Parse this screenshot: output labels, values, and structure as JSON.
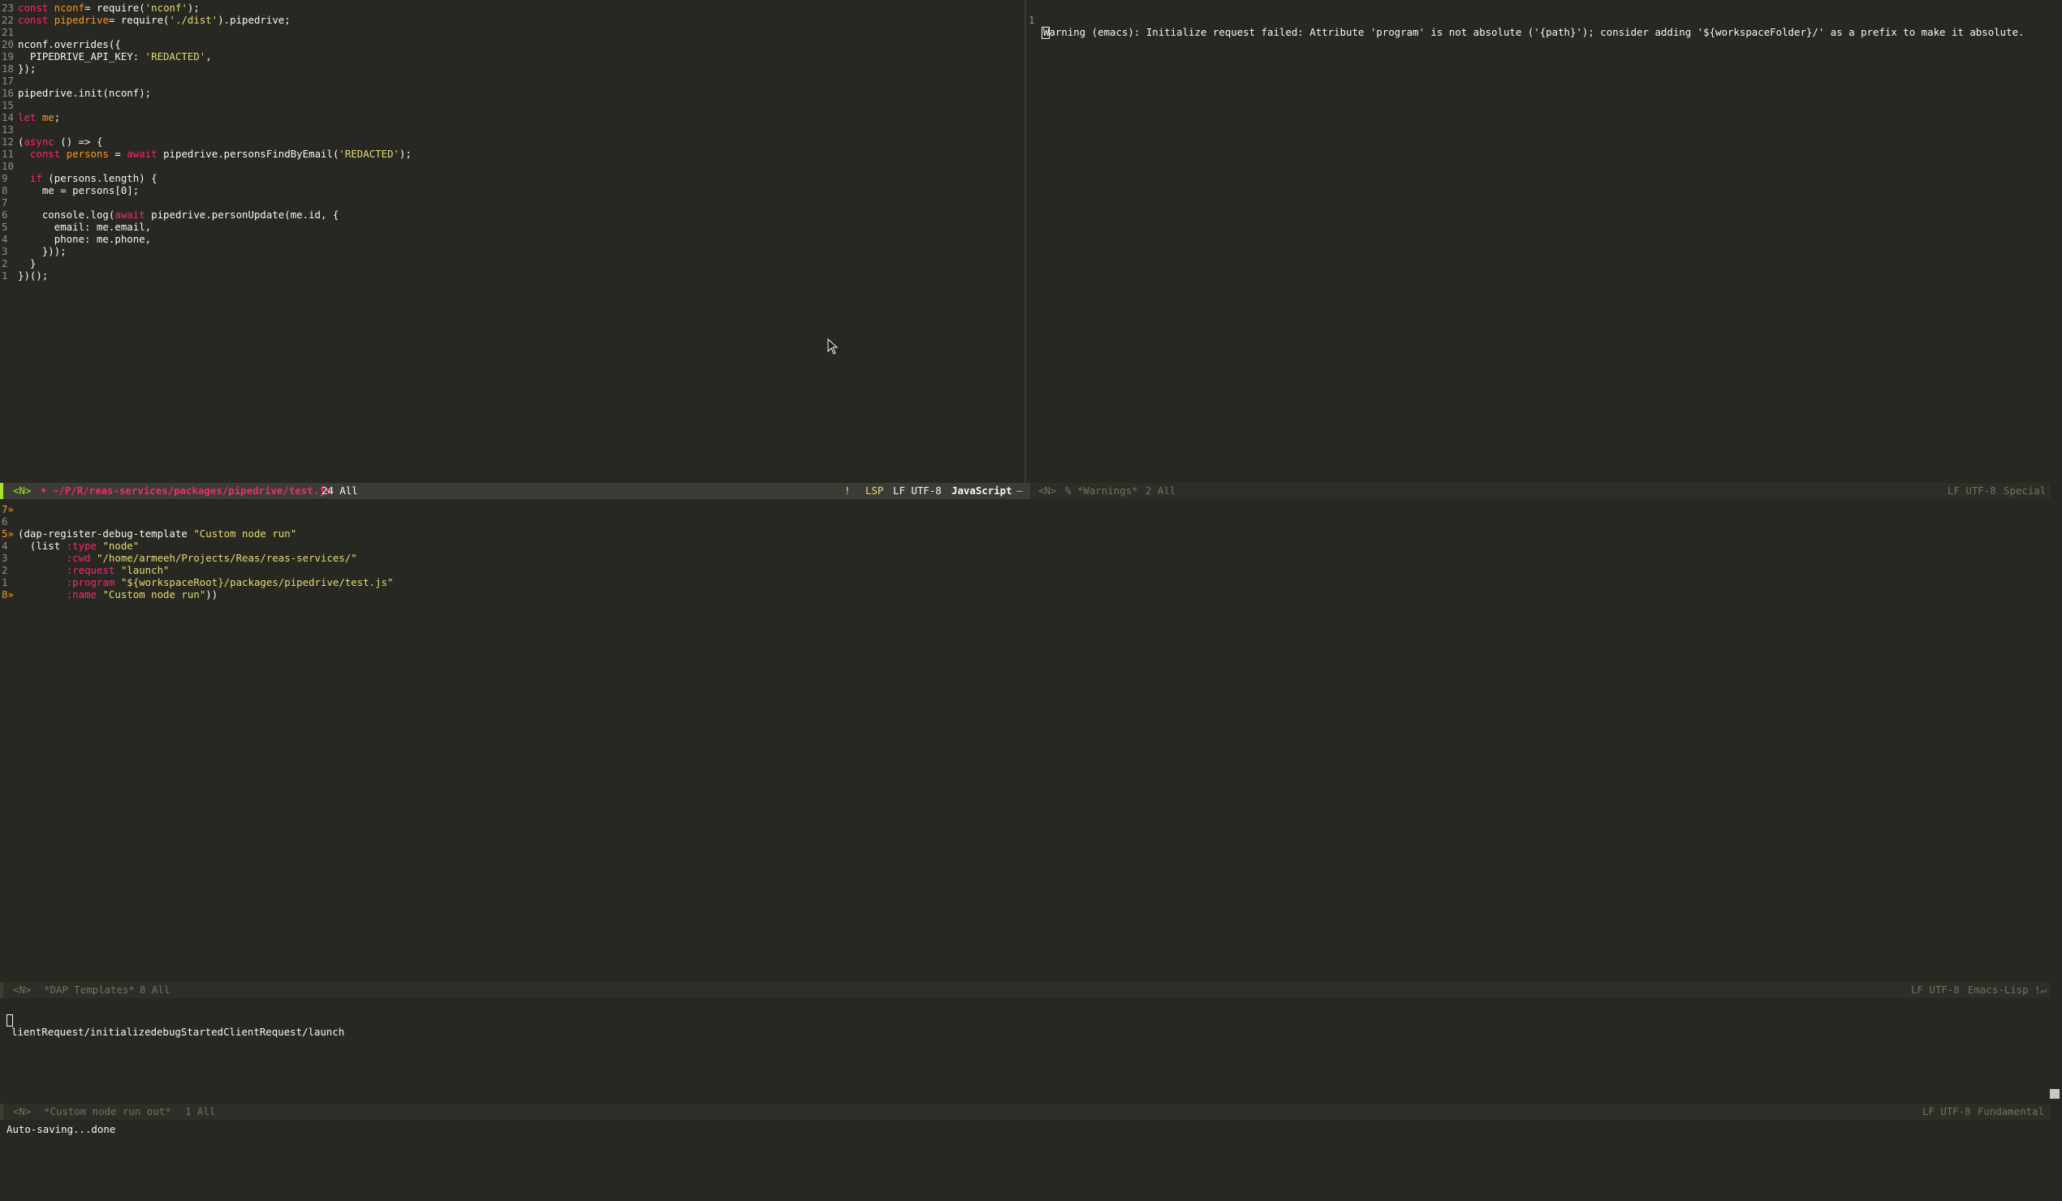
{
  "left_editor": {
    "lines": [
      {
        "n": "23",
        "t": [
          [
            "kw",
            "const "
          ],
          [
            "var",
            "nconf"
          ],
          [
            "",
            "= require("
          ],
          [
            "str",
            "'nconf'"
          ],
          [
            "",
            ");"
          ]
        ]
      },
      {
        "n": "22",
        "t": [
          [
            "kw",
            "const "
          ],
          [
            "var",
            "pipedrive"
          ],
          [
            "",
            "= require("
          ],
          [
            "str",
            "'./dist'"
          ],
          [
            "",
            ").pipedrive;"
          ]
        ]
      },
      {
        "n": "21",
        "t": []
      },
      {
        "n": "20",
        "t": [
          [
            "",
            "nconf.overrides({"
          ]
        ]
      },
      {
        "n": "19",
        "t": [
          [
            "",
            "  PIPEDRIVE_API_KEY: "
          ],
          [
            "str",
            "'REDACTED'"
          ],
          [
            "",
            ","
          ]
        ]
      },
      {
        "n": "18",
        "t": [
          [
            "",
            "});"
          ]
        ]
      },
      {
        "n": "17",
        "t": []
      },
      {
        "n": "16",
        "t": [
          [
            "",
            "pipedrive.init(nconf);"
          ]
        ]
      },
      {
        "n": "15",
        "t": []
      },
      {
        "n": "14",
        "t": [
          [
            "kw",
            "let "
          ],
          [
            "var",
            "me"
          ],
          [
            "",
            ";"
          ]
        ]
      },
      {
        "n": "13",
        "t": []
      },
      {
        "n": "12",
        "t": [
          [
            "",
            "("
          ],
          [
            "kw",
            "async"
          ],
          [
            "",
            " () => {"
          ]
        ]
      },
      {
        "n": "11",
        "t": [
          [
            "",
            "  "
          ],
          [
            "kw",
            "const "
          ],
          [
            "var",
            "persons"
          ],
          [
            "",
            " = "
          ],
          [
            "kw",
            "await"
          ],
          [
            "",
            " pipedrive.personsFindByEmail("
          ],
          [
            "str",
            "'REDACTED'"
          ],
          [
            "",
            ");"
          ]
        ]
      },
      {
        "n": "10",
        "t": []
      },
      {
        "n": "9",
        "t": [
          [
            "",
            "  "
          ],
          [
            "kw",
            "if"
          ],
          [
            "",
            " (persons.length) {"
          ]
        ]
      },
      {
        "n": "8",
        "t": [
          [
            "",
            "    me = persons[0];"
          ]
        ]
      },
      {
        "n": "7",
        "t": []
      },
      {
        "n": "6",
        "t": [
          [
            "",
            "    console.log("
          ],
          [
            "kw",
            "await"
          ],
          [
            "",
            " pipedrive.personUpdate(me.id, {"
          ]
        ]
      },
      {
        "n": "5",
        "t": [
          [
            "",
            "      email: me.email,"
          ]
        ]
      },
      {
        "n": "4",
        "t": [
          [
            "",
            "      phone: me.phone,"
          ]
        ]
      },
      {
        "n": "3",
        "t": [
          [
            "",
            "    }));"
          ]
        ]
      },
      {
        "n": "2",
        "t": [
          [
            "",
            "  }"
          ]
        ]
      },
      {
        "n": "1",
        "t": [
          [
            "",
            "})();"
          ]
        ]
      }
    ]
  },
  "left_modeline": {
    "state": "<N>",
    "path": "• ~/P/R/reas-services/packages/pipedrive/test.js",
    "position": "24 All",
    "flag": "!",
    "lsp": "LSP",
    "encoding": "LF UTF-8",
    "mode": "JavaScript",
    "suffix": "–"
  },
  "right_editor": {
    "line_num": "1",
    "text": "Warning (emacs): Initialize request failed: Attribute 'program' is not absolute ('{path}'); consider adding '${workspaceFolder}/' as a prefix to make it absolute."
  },
  "right_modeline": {
    "state": "<N>",
    "name": "% *Warnings*",
    "position": "2 All",
    "encoding": "LF UTF-8",
    "mode": "Special"
  },
  "middle_editor": {
    "lines": [
      {
        "n": "7»",
        "t": []
      },
      {
        "n": "6",
        "t": []
      },
      {
        "n": "5»",
        "t": [
          [
            "",
            "(dap-register-debug-template "
          ],
          [
            "str",
            "\"Custom node run\""
          ]
        ]
      },
      {
        "n": "4",
        "t": [
          [
            "",
            "  (list "
          ],
          [
            "sym",
            ":type"
          ],
          [
            "str",
            " \"node\""
          ]
        ]
      },
      {
        "n": "3",
        "t": [
          [
            "",
            "        "
          ],
          [
            "sym",
            ":cwd"
          ],
          [
            "str",
            " \"/home/armeeh/Projects/Reas/reas-services/\""
          ]
        ]
      },
      {
        "n": "2",
        "t": [
          [
            "",
            "        "
          ],
          [
            "sym",
            ":request"
          ],
          [
            "str",
            " \"launch\""
          ]
        ]
      },
      {
        "n": "1",
        "t": [
          [
            "",
            "        "
          ],
          [
            "sym",
            ":program"
          ],
          [
            "str",
            " \"${workspaceRoot}/packages/pipedrive/test.js\""
          ]
        ]
      },
      {
        "n": "8»",
        "t": [
          [
            "",
            "        "
          ],
          [
            "sym",
            ":name"
          ],
          [
            "str",
            " \"Custom node run\""
          ],
          [
            "",
            "))"
          ]
        ]
      }
    ]
  },
  "middle_modeline": {
    "state": "<N>",
    "name": "*DAP Templates*",
    "position": "8 All",
    "encoding": "LF UTF-8",
    "mode": "Emacs-Lisp",
    "suffix": "!↵"
  },
  "output_editor": {
    "text": "lientRequest/initializedebugStartedClientRequest/launch"
  },
  "output_modeline": {
    "state": "<N>",
    "name": "*Custom node run out*",
    "position": "1 All",
    "encoding": "LF UTF-8",
    "mode": "Fundamental"
  },
  "minibuffer": {
    "message": "Auto-saving...done"
  },
  "colors": {
    "background": "#272822",
    "keyword": "#f92672",
    "variable": "#fd971f",
    "string": "#e6db74",
    "line_number": "#8f908a",
    "modeline_active": "#3b3c35",
    "modeline_inactive": "#2d2e27"
  }
}
